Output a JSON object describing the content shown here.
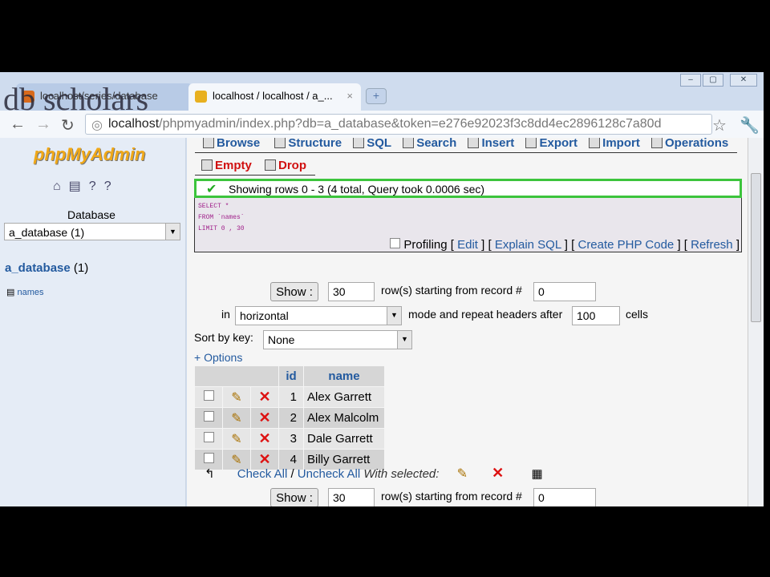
{
  "watermark": "db scholars",
  "browser": {
    "tabs": [
      {
        "label": "localhost/series/database"
      },
      {
        "label": "localhost / localhost / a_...",
        "close": "×"
      }
    ],
    "new_tab": "+",
    "window_controls": [
      "–",
      "▢",
      "✕"
    ],
    "url_host": "localhost",
    "url_path": "/phpmyadmin/index.php?db=a_database&token=e276e92023f3c8dd4ec2896128c7a80d"
  },
  "sidebar": {
    "logo": "phpMyAdmin",
    "database_label": "Database",
    "database_select": "a_database (1)",
    "db_heading": "a_database",
    "db_count": "(1)",
    "tables": [
      "names"
    ]
  },
  "main": {
    "tabs": [
      "Browse",
      "Structure",
      "SQL",
      "Search",
      "Insert",
      "Export",
      "Import",
      "Operations"
    ],
    "tabs2": [
      "Empty",
      "Drop"
    ],
    "success": "Showing rows 0 - 3 (4 total, Query took 0.0006 sec)",
    "sql": [
      "SELECT *",
      "FROM `names`",
      "LIMIT 0 , 30"
    ],
    "profiling": "Profiling",
    "links": [
      "Edit",
      "Explain SQL",
      "Create PHP Code",
      "Refresh"
    ],
    "show_button": "Show :",
    "show_rows": "30",
    "rows_from_label": "row(s) starting from record #",
    "start_record": "0",
    "in_label": "in",
    "mode": "horizontal",
    "mode_label": "mode and repeat headers after",
    "repeat": "100",
    "cells_label": "cells",
    "sort_label": "Sort by key:",
    "sort_value": "None",
    "options": "+ Options",
    "columns": [
      "id",
      "name"
    ],
    "rows": [
      {
        "id": "1",
        "name": "Alex Garrett"
      },
      {
        "id": "2",
        "name": "Alex Malcolm"
      },
      {
        "id": "3",
        "name": "Dale Garrett"
      },
      {
        "id": "4",
        "name": "Billy Garrett"
      }
    ],
    "check_all": "Check All",
    "sep": "/",
    "uncheck_all": "Uncheck All",
    "with_selected": "With selected:"
  }
}
